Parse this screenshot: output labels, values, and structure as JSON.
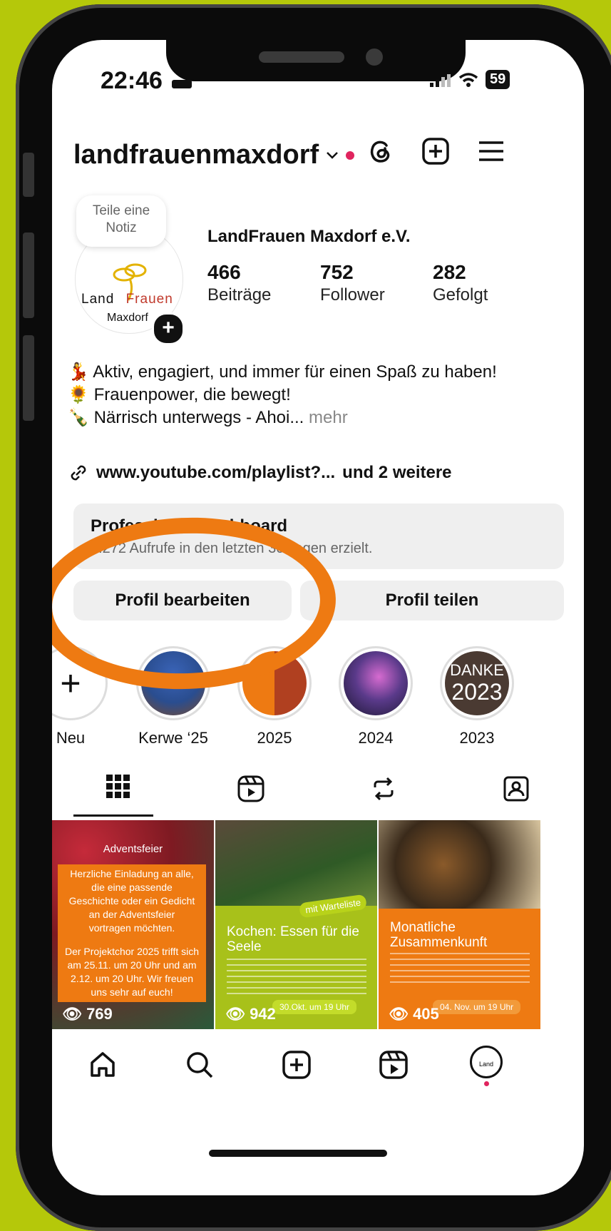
{
  "status": {
    "time": "22:46",
    "battery": "59"
  },
  "profile": {
    "username": "landfrauenmaxdorf",
    "note": "Teile eine Notiz",
    "logo_top": "Land",
    "logo_right": "Frauen",
    "logo_bottom": "Maxdorf",
    "display_name": "LandFrauen Maxdorf e.V.",
    "stats": [
      {
        "value": "466",
        "label": "Beiträge"
      },
      {
        "value": "752",
        "label": "Follower"
      },
      {
        "value": "282",
        "label": "Gefolgt"
      }
    ],
    "bio": [
      {
        "emoji": "💃",
        "text": "Aktiv, engagiert, und immer für einen Spaß zu haben!"
      },
      {
        "emoji": "🌻",
        "text": "Frauenpower, die bewegt!"
      },
      {
        "emoji": "🍾",
        "text": "Närrisch unterwegs - Ahoi..."
      }
    ],
    "bio_more": "mehr",
    "link": "www.youtube.com/playlist?...",
    "link_more": "und 2 weitere"
  },
  "dashboard": {
    "title": "Professional Dashboard",
    "subtitle": "3.272 Aufrufe in den letzten 30 Tagen erzielt."
  },
  "buttons": {
    "edit": "Profil bearbeiten",
    "share": "Profil teilen"
  },
  "highlights": [
    {
      "label": "Neu"
    },
    {
      "label": "Kerwe ‘25"
    },
    {
      "label": "2025"
    },
    {
      "label": "2024"
    },
    {
      "label": "2023"
    }
  ],
  "highlight_2023_text": [
    "DANKE",
    "2023"
  ],
  "posts": [
    {
      "views": "769",
      "title": "Adventsfeier",
      "lines": [
        "Herzliche Einladung an alle,",
        "die eine passende",
        "Geschichte oder ein Gedicht",
        "an der Adventsfeier",
        "vortragen möchten.",
        "Der Projektchor 2025 trifft sich",
        "am 25.11. um 20 Uhr und am",
        "2.12. um 20 Uhr. Wir freuen",
        "uns sehr auf euch!"
      ]
    },
    {
      "views": "942",
      "tag": "mit Warteliste",
      "title": "Kochen: Essen für die Seele",
      "date": "30.Okt. um 19 Uhr"
    },
    {
      "views": "405",
      "title": "Monatliche Zusammenkunft",
      "date": "04. Nov. um 19 Uhr"
    }
  ],
  "icon_colors": {
    "accent": "#ee7a12",
    "notif": "#e0245e"
  }
}
